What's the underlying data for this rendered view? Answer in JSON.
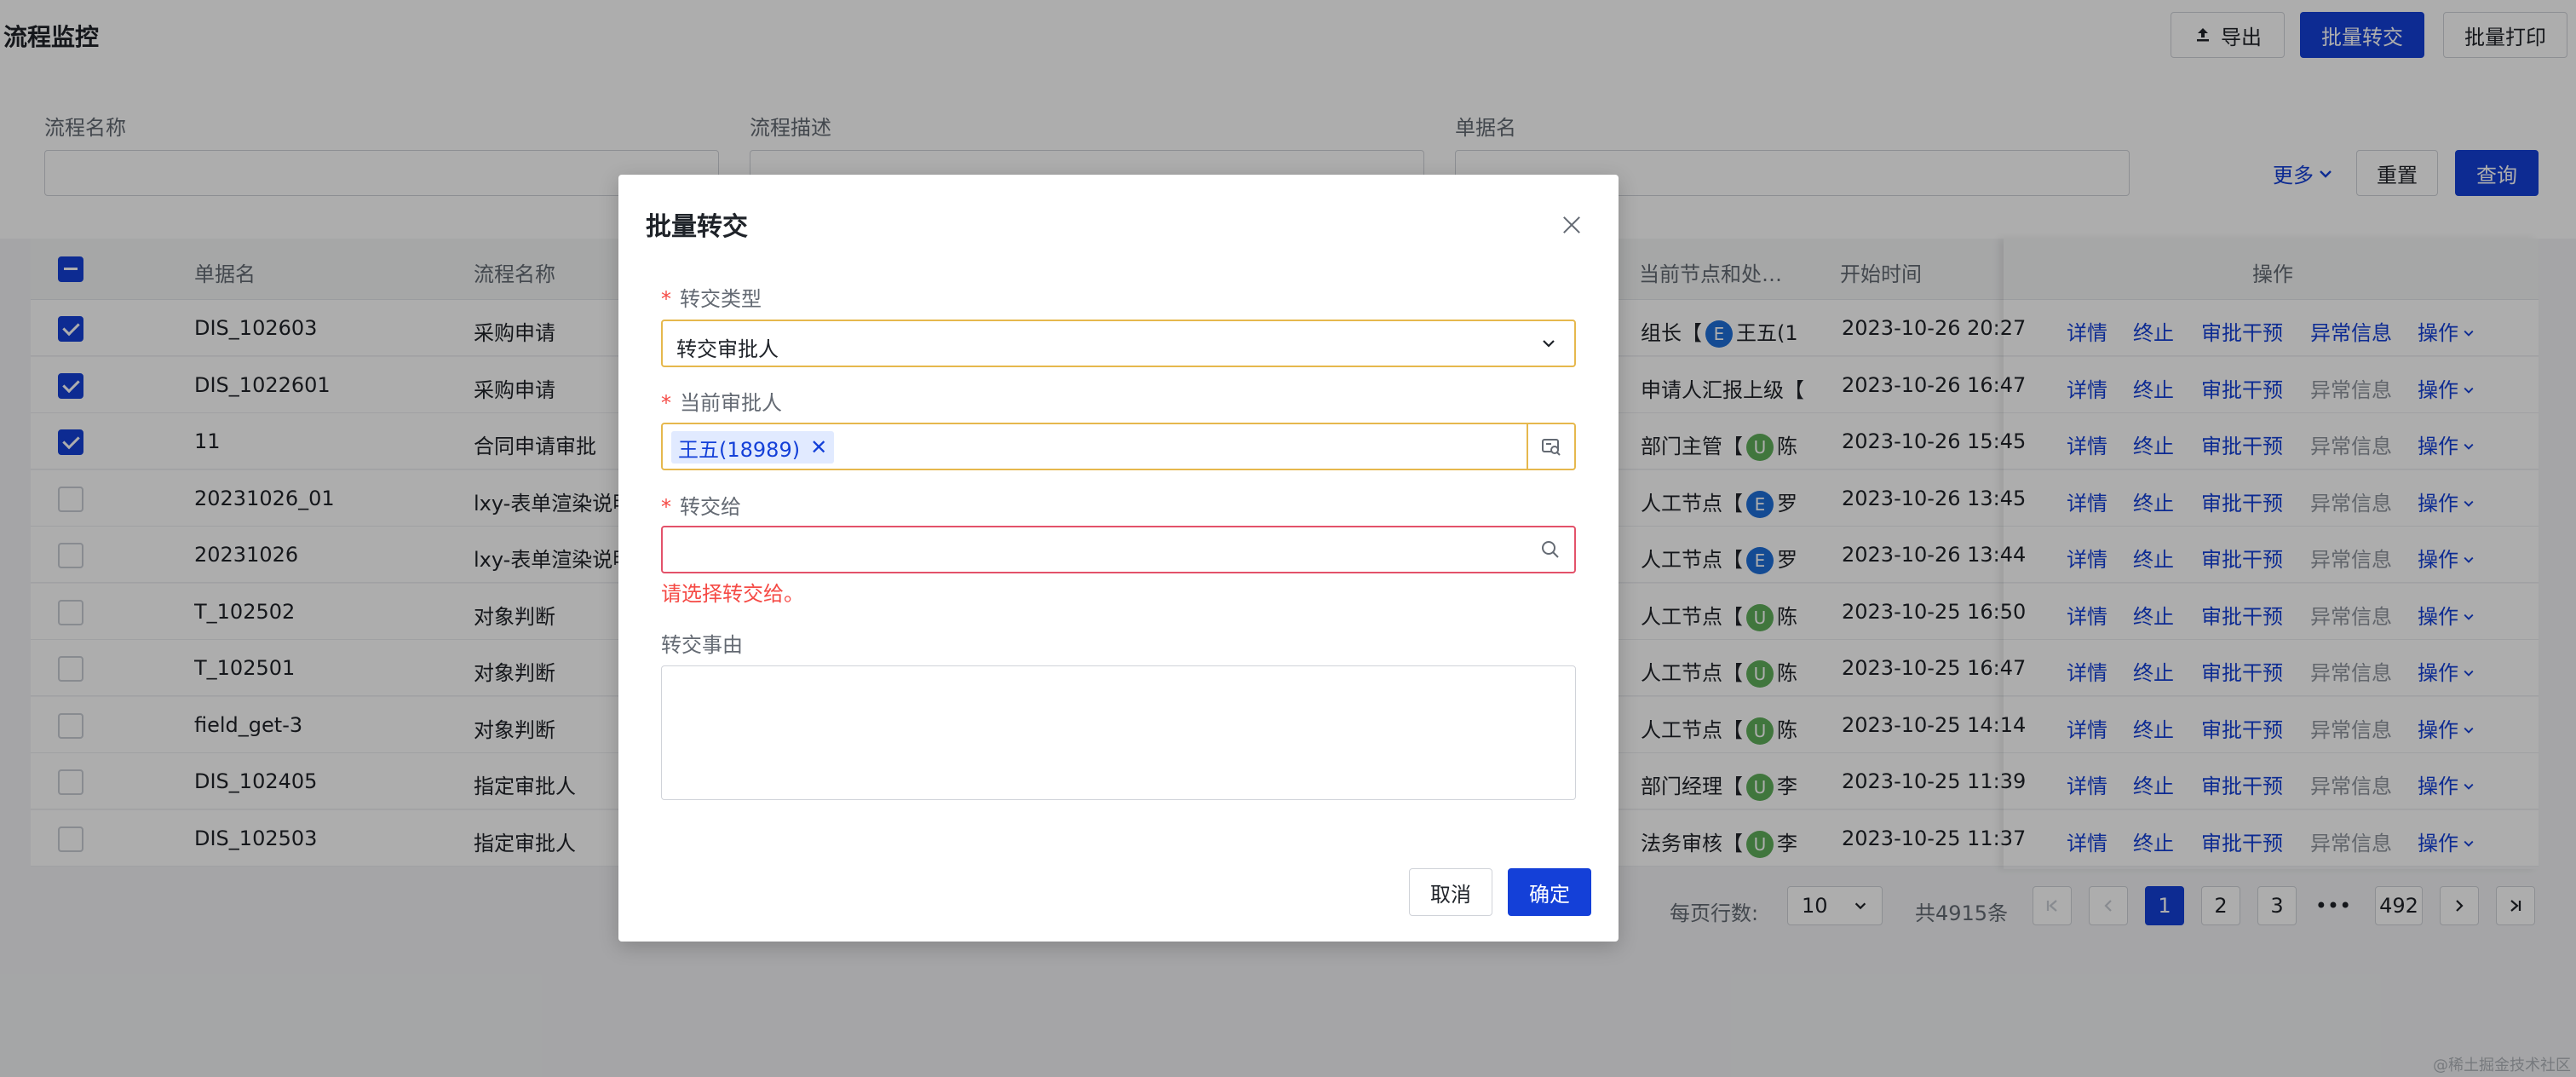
{
  "header": {
    "title": "流程监控",
    "export_label": "导出",
    "batch_transfer_label": "批量转交",
    "batch_print_label": "批量打印"
  },
  "filters": {
    "process_name_label": "流程名称",
    "process_desc_label": "流程描述",
    "doc_name_label": "单据名",
    "more_label": "更多",
    "reset_label": "重置",
    "query_label": "查询"
  },
  "table": {
    "headers": {
      "doc_name": "单据名",
      "process_name": "流程名称",
      "current_node": "当前节点和处…",
      "start_time": "开始时间",
      "operations": "操作"
    },
    "rows": [
      {
        "checked": true,
        "doc": "DIS_102603",
        "process": "采购申请",
        "node": "组长【",
        "avatar": "E",
        "handler": "王五(1",
        "time": "2023-10-26 20:27",
        "exception_active": true
      },
      {
        "checked": true,
        "doc": "DIS_1022601",
        "process": "采购申请",
        "node": "申请人汇报上级【",
        "avatar": "",
        "handler": "",
        "time": "2023-10-26 16:47",
        "exception_active": false
      },
      {
        "checked": true,
        "doc": "11",
        "process": "合同申请审批",
        "node": "部门主管【",
        "avatar": "U",
        "handler": "陈",
        "time": "2023-10-26 15:45",
        "exception_active": false
      },
      {
        "checked": false,
        "doc": "20231026_01",
        "process": "lxy-表单渲染说明",
        "node": "人工节点【",
        "avatar": "E",
        "handler": "罗",
        "time": "2023-10-26 13:45",
        "exception_active": false
      },
      {
        "checked": false,
        "doc": "20231026",
        "process": "lxy-表单渲染说明",
        "node": "人工节点【",
        "avatar": "E",
        "handler": "罗",
        "time": "2023-10-26 13:44",
        "exception_active": false
      },
      {
        "checked": false,
        "doc": "T_102502",
        "process": "对象判断",
        "node": "人工节点【",
        "avatar": "U",
        "handler": "陈",
        "time": "2023-10-25 16:50",
        "exception_active": false
      },
      {
        "checked": false,
        "doc": "T_102501",
        "process": "对象判断",
        "node": "人工节点【",
        "avatar": "U",
        "handler": "陈",
        "time": "2023-10-25 16:47",
        "exception_active": false
      },
      {
        "checked": false,
        "doc": "field_get-3",
        "process": "对象判断",
        "node": "人工节点【",
        "avatar": "U",
        "handler": "陈",
        "time": "2023-10-25 14:14",
        "exception_active": false
      },
      {
        "checked": false,
        "doc": "DIS_102405",
        "process": "指定审批人",
        "node": "部门经理【",
        "avatar": "U",
        "handler": "李",
        "time": "2023-10-25 11:39",
        "exception_active": false
      },
      {
        "checked": false,
        "doc": "DIS_102503",
        "process": "指定审批人",
        "node": "法务审核【",
        "avatar": "U",
        "handler": "李",
        "time": "2023-10-25 11:37",
        "exception_active": false
      }
    ],
    "actions": {
      "detail": "详情",
      "terminate": "终止",
      "intervene": "审批干预",
      "exception": "异常信息",
      "more": "操作"
    }
  },
  "pagination": {
    "page_size_label": "每页行数:",
    "page_size": "10",
    "total": "共4915条",
    "pages": [
      "1",
      "2",
      "3"
    ],
    "ellipsis": "•••",
    "last_page": "492",
    "current": "1"
  },
  "modal": {
    "title": "批量转交",
    "transfer_type_label": "转交类型",
    "transfer_type_value": "转交审批人",
    "current_approver_label": "当前审批人",
    "current_approver_tag": "王五(18989)",
    "transfer_to_label": "转交给",
    "transfer_to_value": "",
    "transfer_to_error": "请选择转交给。",
    "reason_label": "转交事由",
    "reason_value": "",
    "cancel_label": "取消",
    "confirm_label": "确定"
  },
  "colors": {
    "primary": "#1440d8",
    "error": "#f54a45",
    "warning_border": "#e6b84d"
  },
  "watermark": "@稀土掘金技术社区"
}
